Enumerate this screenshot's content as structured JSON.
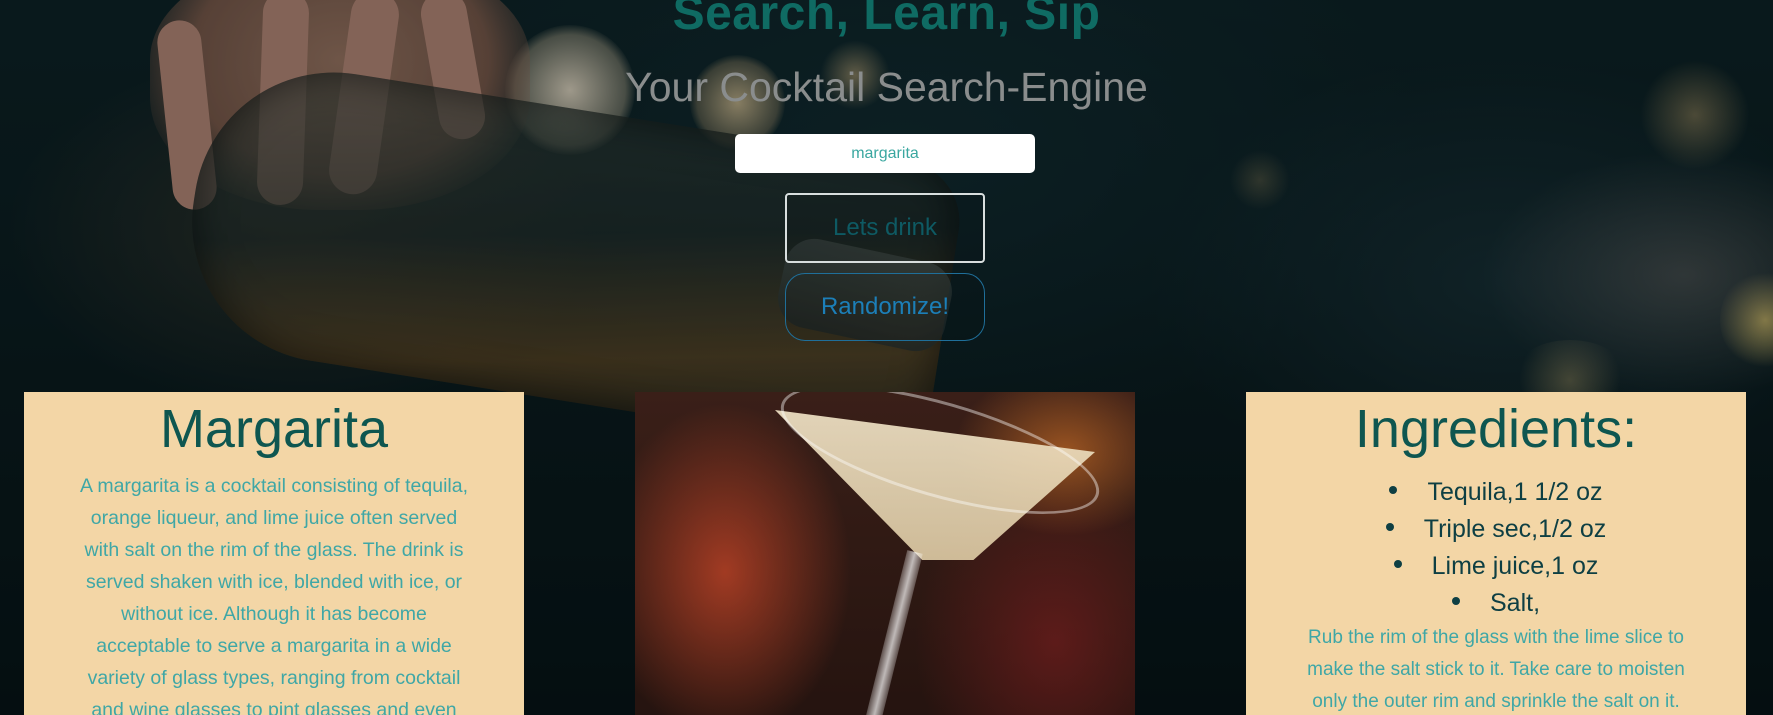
{
  "hero": {
    "title": "Search, Learn, Sip",
    "subtitle": "Your Cocktail Search-Engine"
  },
  "search": {
    "value": "margarita"
  },
  "buttons": {
    "drink_label": "Lets drink",
    "randomize_label": "Randomize!"
  },
  "drink": {
    "name": "Margarita",
    "description": "A margarita is a cocktail consisting of tequila, orange liqueur, and lime juice often served with salt on the rim of the glass. The drink is served shaken with ice, blended with ice, or without ice. Although it has become acceptable to serve a margarita in a wide variety of glass types, ranging from cocktail and wine glasses to pint glasses and even"
  },
  "ingredients": {
    "heading": "Ingredients:",
    "items": [
      "Tequila,1 1/2 oz",
      "Triple sec,1/2 oz",
      "Lime juice,1 oz",
      "Salt,"
    ],
    "instructions": "Rub the rim of the glass with the lime slice to make the salt stick to it. Take care to moisten only the outer rim and sprinkle the salt on it."
  },
  "colors": {
    "card_bg": "#f3d6a6",
    "accent_teal": "#0e5650",
    "text_teal": "#3fa7a6",
    "title_teal": "#0f6b63"
  }
}
